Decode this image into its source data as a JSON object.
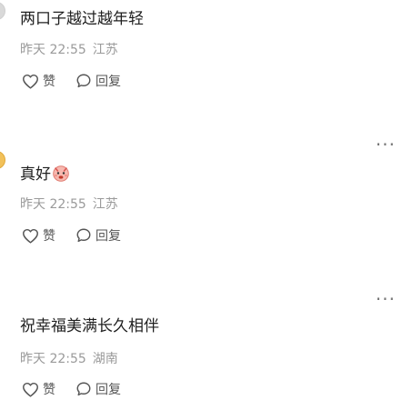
{
  "comments": [
    {
      "text": "两口子越过越年轻",
      "time": "昨天 22:55",
      "location": "江苏",
      "like_label": "赞",
      "reply_label": "回复"
    },
    {
      "text": "真好",
      "emoji": "pouty-face-emoji",
      "time": "昨天 22:55",
      "location": "江苏",
      "like_label": "赞",
      "reply_label": "回复",
      "more": "···"
    },
    {
      "text": "祝幸福美满长久相伴",
      "time": "昨天 22:55",
      "location": "湖南",
      "like_label": "赞",
      "reply_label": "回复",
      "more": "···"
    }
  ],
  "icons": {
    "like": "heart-outline-icon",
    "reply": "speech-bubble-icon",
    "more": "more-dots-icon"
  }
}
